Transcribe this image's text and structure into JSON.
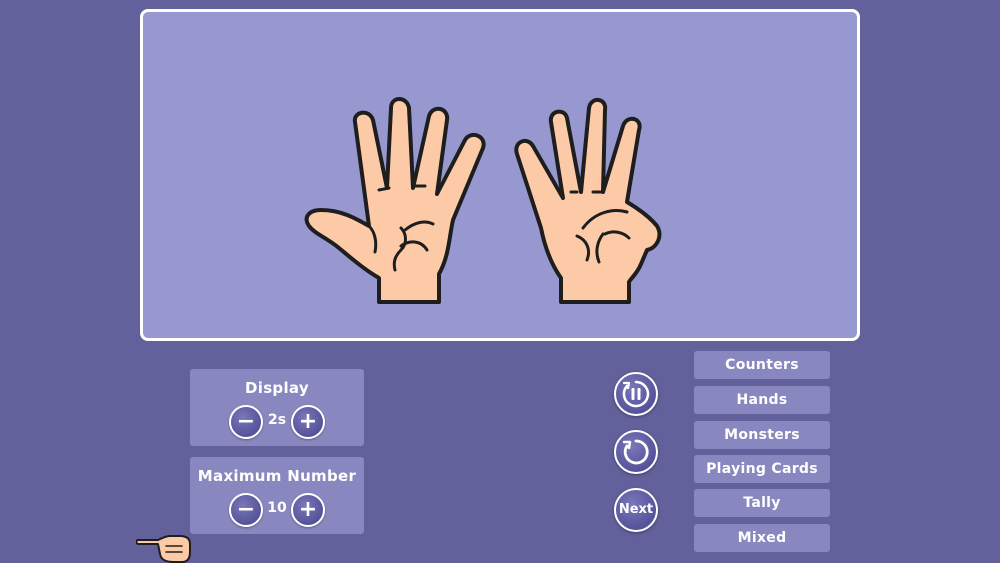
{
  "display_panel": {
    "title": "Display",
    "value": "2s",
    "decrease_label": "−",
    "increase_label": "+"
  },
  "max_panel": {
    "title": "Maximum Number",
    "value": "10",
    "decrease_label": "−",
    "increase_label": "+"
  },
  "controls": {
    "pause_icon": "pause-icon",
    "restart_icon": "restart-icon",
    "next_label": "Next"
  },
  "modes": [
    "Counters",
    "Hands",
    "Monsters",
    "Playing Cards",
    "Tally",
    "Mixed"
  ],
  "stage": {
    "left_hand_fingers": 5,
    "right_hand_fingers": 4
  },
  "colors": {
    "background": "#63619c",
    "stage": "#9898d0",
    "panel": "#8987bf",
    "skin": "#fdcaa8",
    "outline": "#1e1e1e"
  }
}
